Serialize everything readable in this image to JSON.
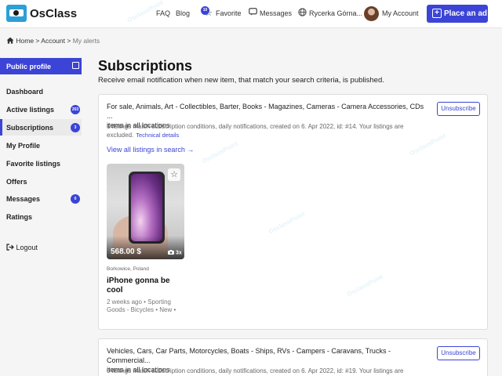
{
  "header": {
    "logo": "OsClass",
    "nav": {
      "faq": "FAQ",
      "blog": "Blog",
      "favorite": "Favorite",
      "favorite_count": "10",
      "messages": "Messages",
      "user": "Rycerka Górna...",
      "account": "My Account"
    },
    "place_ad": "Place an ad",
    "accent": "#3b44d6"
  },
  "breadcrumb": {
    "home": "Home",
    "account": "Account",
    "current": "My alerts"
  },
  "sidebar": {
    "profile": "Public profile",
    "items": [
      {
        "label": "Dashboard"
      },
      {
        "label": "Active listings",
        "badge": "203"
      },
      {
        "label": "Subscriptions",
        "badge": "3"
      },
      {
        "label": "My Profile"
      },
      {
        "label": "Favorite listings"
      },
      {
        "label": "Offers"
      },
      {
        "label": "Messages",
        "badge": "0"
      },
      {
        "label": "Ratings"
      }
    ],
    "logout": "Logout"
  },
  "main": {
    "title": "Subscriptions",
    "subtitle": "Receive email notification when new item, that match your search criteria, is published.",
    "subscriptions": [
      {
        "categories": "For sale, Animals, Art - Collectibles, Barter, Books - Magazines, Cameras - Camera Accessories, CDs ...",
        "scope": "items in all locations",
        "info": "1 listings match subscription conditions, daily notifications, created on 6. Apr 2022, id: #14. Your listings are excluded.",
        "tech": "Technical details",
        "unsubscribe": "Unsubscribe",
        "view_all": "View all listings in search →",
        "listing": {
          "price": "568.00 $",
          "photos": "3x",
          "location": "Borkowice, Poland",
          "title": "iPhone gonna be cool",
          "meta": "2 weeks ago • Sporting Goods - Bicycles • New •"
        }
      },
      {
        "categories": "Vehicles, Cars, Car Parts, Motorcycles, Boats - Ships, RVs - Campers - Caravans, Trucks - Commercial...",
        "scope": "items in all locations",
        "info": "0 listings match subscription conditions, daily notifications, created on 6. Apr 2022, id: #19. Your listings are",
        "unsubscribe": "Unsubscribe"
      }
    ]
  }
}
